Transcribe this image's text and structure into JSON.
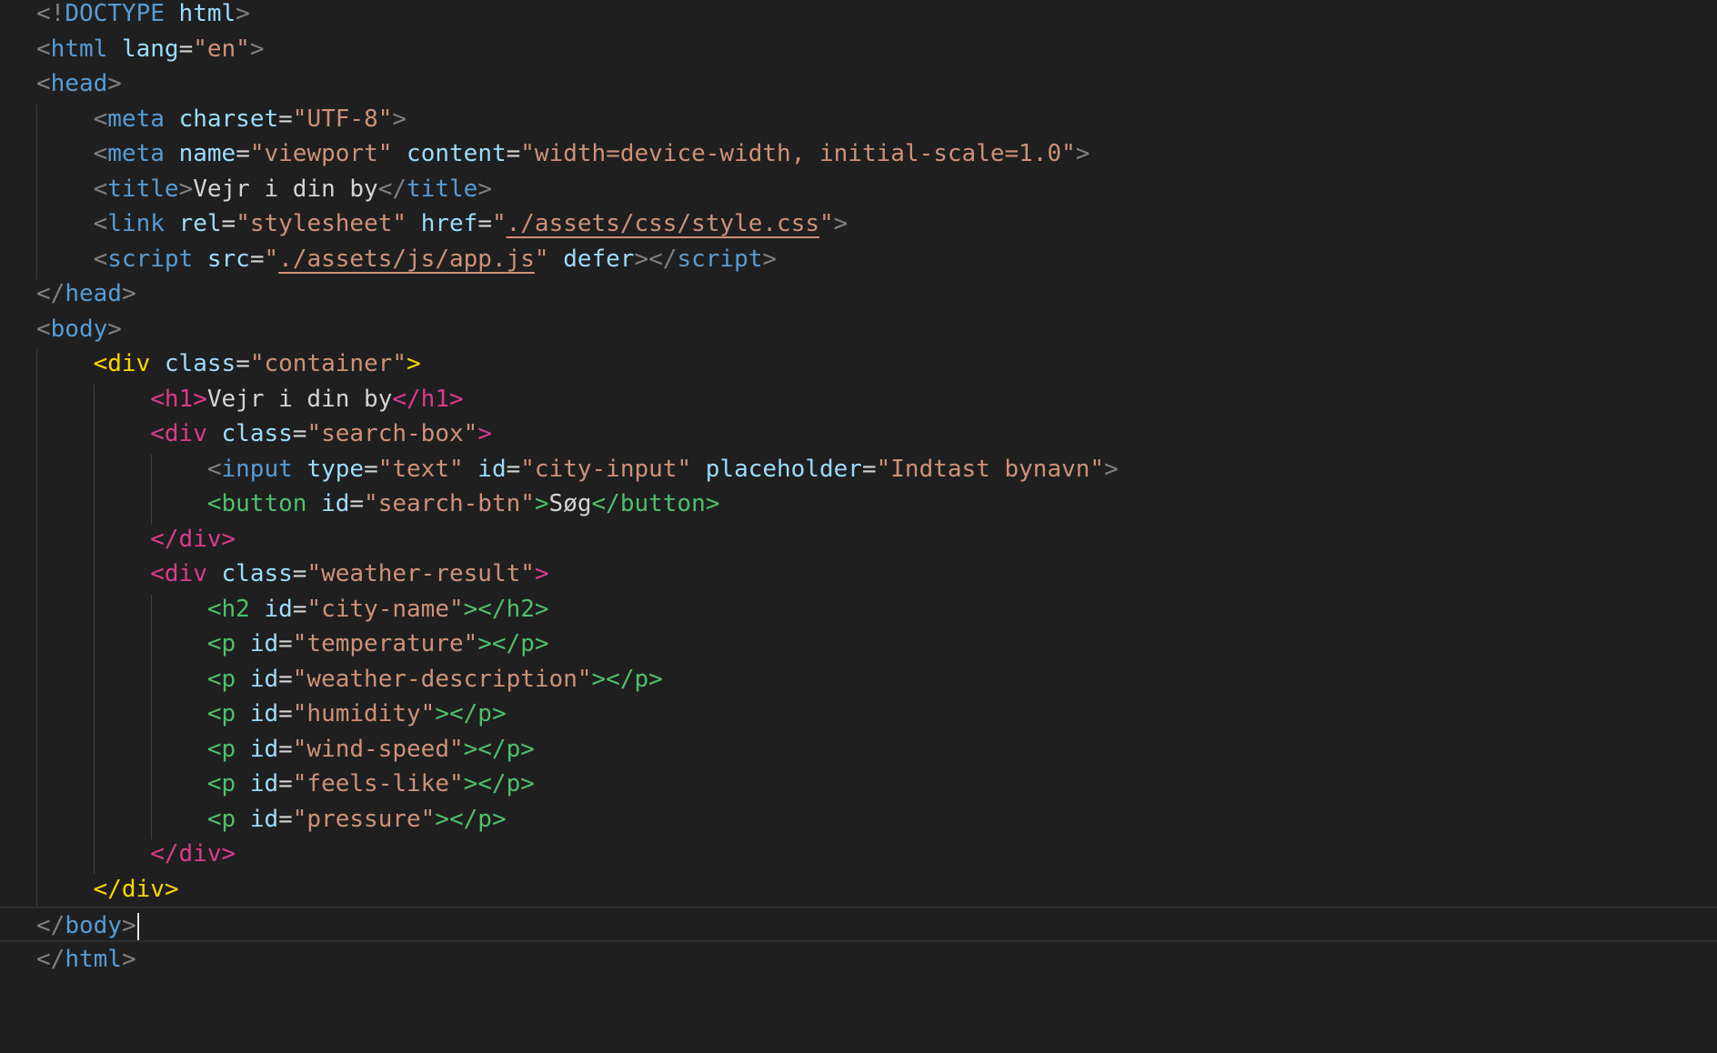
{
  "editor": {
    "language": "html",
    "lines": [
      [
        [
          "p",
          "<!"
        ],
        [
          "t",
          "DOCTYPE"
        ],
        [
          "x",
          " "
        ],
        [
          "a",
          "html"
        ],
        [
          "p",
          ">"
        ]
      ],
      [
        [
          "p",
          "<"
        ],
        [
          "t",
          "html"
        ],
        [
          "x",
          " "
        ],
        [
          "a",
          "lang"
        ],
        [
          "x",
          "="
        ],
        [
          "s",
          "\"en\""
        ],
        [
          "p",
          ">"
        ]
      ],
      [
        [
          "p",
          "<"
        ],
        [
          "t",
          "head"
        ],
        [
          "p",
          ">"
        ]
      ],
      [
        [
          "x",
          "    "
        ],
        [
          "p",
          "<"
        ],
        [
          "t",
          "meta"
        ],
        [
          "x",
          " "
        ],
        [
          "a",
          "charset"
        ],
        [
          "x",
          "="
        ],
        [
          "s",
          "\"UTF-8\""
        ],
        [
          "p",
          ">"
        ]
      ],
      [
        [
          "x",
          "    "
        ],
        [
          "p",
          "<"
        ],
        [
          "t",
          "meta"
        ],
        [
          "x",
          " "
        ],
        [
          "a",
          "name"
        ],
        [
          "x",
          "="
        ],
        [
          "s",
          "\"viewport\""
        ],
        [
          "x",
          " "
        ],
        [
          "a",
          "content"
        ],
        [
          "x",
          "="
        ],
        [
          "s",
          "\"width=device-width, initial-scale=1.0\""
        ],
        [
          "p",
          ">"
        ]
      ],
      [
        [
          "x",
          "    "
        ],
        [
          "p",
          "<"
        ],
        [
          "t",
          "title"
        ],
        [
          "p",
          ">"
        ],
        [
          "x",
          "Vejr i din by"
        ],
        [
          "p",
          "</"
        ],
        [
          "t",
          "title"
        ],
        [
          "p",
          ">"
        ]
      ],
      [
        [
          "x",
          "    "
        ],
        [
          "p",
          "<"
        ],
        [
          "t",
          "link"
        ],
        [
          "x",
          " "
        ],
        [
          "a",
          "rel"
        ],
        [
          "x",
          "="
        ],
        [
          "s",
          "\"stylesheet\""
        ],
        [
          "x",
          " "
        ],
        [
          "a",
          "href"
        ],
        [
          "x",
          "="
        ],
        [
          "s",
          "\""
        ],
        [
          "su",
          "./assets/css/style.css"
        ],
        [
          "s",
          "\""
        ],
        [
          "p",
          ">"
        ]
      ],
      [
        [
          "x",
          "    "
        ],
        [
          "p",
          "<"
        ],
        [
          "t",
          "script"
        ],
        [
          "x",
          " "
        ],
        [
          "a",
          "src"
        ],
        [
          "x",
          "="
        ],
        [
          "s",
          "\""
        ],
        [
          "su",
          "./assets/js/app.js"
        ],
        [
          "s",
          "\""
        ],
        [
          "x",
          " "
        ],
        [
          "a",
          "defer"
        ],
        [
          "p",
          "></"
        ],
        [
          "t",
          "script"
        ],
        [
          "p",
          ">"
        ]
      ],
      [
        [
          "p",
          "</"
        ],
        [
          "t",
          "head"
        ],
        [
          "p",
          ">"
        ]
      ],
      [
        [
          "p",
          "<"
        ],
        [
          "t",
          "body"
        ],
        [
          "p",
          ">"
        ]
      ],
      [
        [
          "x",
          "    "
        ],
        [
          "y",
          "<div"
        ],
        [
          "x",
          " "
        ],
        [
          "a",
          "class"
        ],
        [
          "x",
          "="
        ],
        [
          "s",
          "\"container\""
        ],
        [
          "y",
          ">"
        ]
      ],
      [
        [
          "x",
          "        "
        ],
        [
          "r",
          "<h1>"
        ],
        [
          "x",
          "Vejr i din by"
        ],
        [
          "r",
          "</h1>"
        ]
      ],
      [
        [
          "x",
          "        "
        ],
        [
          "r",
          "<div"
        ],
        [
          "x",
          " "
        ],
        [
          "a",
          "class"
        ],
        [
          "x",
          "="
        ],
        [
          "s",
          "\"search-box\""
        ],
        [
          "r",
          ">"
        ]
      ],
      [
        [
          "x",
          "            "
        ],
        [
          "p",
          "<"
        ],
        [
          "t",
          "input"
        ],
        [
          "x",
          " "
        ],
        [
          "a",
          "type"
        ],
        [
          "x",
          "="
        ],
        [
          "s",
          "\"text\""
        ],
        [
          "x",
          " "
        ],
        [
          "a",
          "id"
        ],
        [
          "x",
          "="
        ],
        [
          "s",
          "\"city-input\""
        ],
        [
          "x",
          " "
        ],
        [
          "a",
          "placeholder"
        ],
        [
          "x",
          "="
        ],
        [
          "s",
          "\"Indtast bynavn\""
        ],
        [
          "p",
          ">"
        ]
      ],
      [
        [
          "x",
          "            "
        ],
        [
          "g",
          "<button"
        ],
        [
          "x",
          " "
        ],
        [
          "a",
          "id"
        ],
        [
          "x",
          "="
        ],
        [
          "s",
          "\"search-btn\""
        ],
        [
          "g",
          ">"
        ],
        [
          "x",
          "Søg"
        ],
        [
          "g",
          "</button>"
        ]
      ],
      [
        [
          "x",
          "        "
        ],
        [
          "r",
          "</div>"
        ]
      ],
      [
        [
          "x",
          "        "
        ],
        [
          "r",
          "<div"
        ],
        [
          "x",
          " "
        ],
        [
          "a",
          "class"
        ],
        [
          "x",
          "="
        ],
        [
          "s",
          "\"weather-result\""
        ],
        [
          "r",
          ">"
        ]
      ],
      [
        [
          "x",
          "            "
        ],
        [
          "g",
          "<h2"
        ],
        [
          "x",
          " "
        ],
        [
          "a",
          "id"
        ],
        [
          "x",
          "="
        ],
        [
          "s",
          "\"city-name\""
        ],
        [
          "g",
          "></h2>"
        ]
      ],
      [
        [
          "x",
          "            "
        ],
        [
          "g",
          "<p"
        ],
        [
          "x",
          " "
        ],
        [
          "a",
          "id"
        ],
        [
          "x",
          "="
        ],
        [
          "s",
          "\"temperature\""
        ],
        [
          "g",
          "></p>"
        ]
      ],
      [
        [
          "x",
          "            "
        ],
        [
          "g",
          "<p"
        ],
        [
          "x",
          " "
        ],
        [
          "a",
          "id"
        ],
        [
          "x",
          "="
        ],
        [
          "s",
          "\"weather-description\""
        ],
        [
          "g",
          "></p>"
        ]
      ],
      [
        [
          "x",
          "            "
        ],
        [
          "g",
          "<p"
        ],
        [
          "x",
          " "
        ],
        [
          "a",
          "id"
        ],
        [
          "x",
          "="
        ],
        [
          "s",
          "\"humidity\""
        ],
        [
          "g",
          "></p>"
        ]
      ],
      [
        [
          "x",
          "            "
        ],
        [
          "g",
          "<p"
        ],
        [
          "x",
          " "
        ],
        [
          "a",
          "id"
        ],
        [
          "x",
          "="
        ],
        [
          "s",
          "\"wind-speed\""
        ],
        [
          "g",
          "></p>"
        ]
      ],
      [
        [
          "x",
          "            "
        ],
        [
          "g",
          "<p"
        ],
        [
          "x",
          " "
        ],
        [
          "a",
          "id"
        ],
        [
          "x",
          "="
        ],
        [
          "s",
          "\"feels-like\""
        ],
        [
          "g",
          "></p>"
        ]
      ],
      [
        [
          "x",
          "            "
        ],
        [
          "g",
          "<p"
        ],
        [
          "x",
          " "
        ],
        [
          "a",
          "id"
        ],
        [
          "x",
          "="
        ],
        [
          "s",
          "\"pressure\""
        ],
        [
          "g",
          "></p>"
        ]
      ],
      [
        [
          "x",
          "        "
        ],
        [
          "r",
          "</div>"
        ]
      ],
      [
        [
          "x",
          "    "
        ],
        [
          "y",
          "</div>"
        ]
      ],
      [
        [
          "p",
          "</"
        ],
        [
          "t",
          "body"
        ],
        [
          "p",
          ">"
        ]
      ],
      [
        [
          "p",
          "</"
        ],
        [
          "t",
          "html"
        ],
        [
          "p",
          ">"
        ]
      ]
    ],
    "cursor_line": 26
  }
}
